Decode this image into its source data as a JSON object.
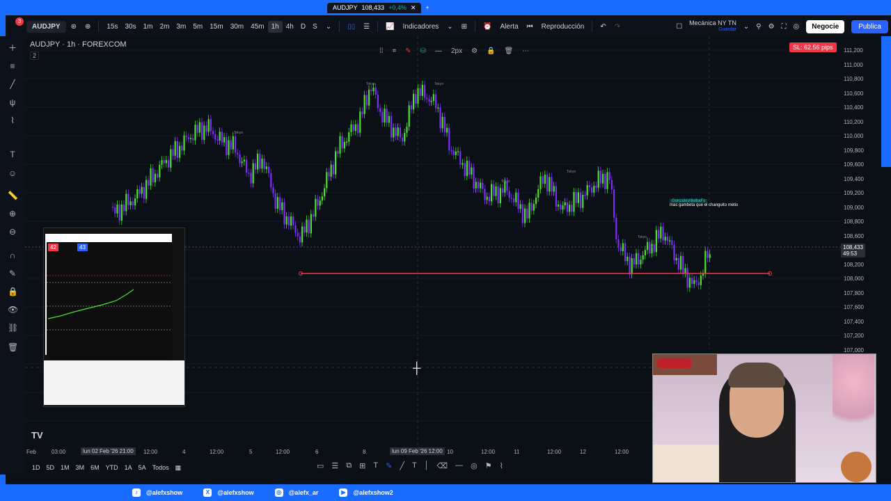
{
  "browser_tab": {
    "symbol": "AUDJPY",
    "price": "108,433",
    "change": "+0,4%"
  },
  "toolbar": {
    "symbol": "AUDJPY",
    "notif_count": "3",
    "timeframes": [
      "15s",
      "30s",
      "1m",
      "2m",
      "3m",
      "5m",
      "15m",
      "30m",
      "45m",
      "1h",
      "4h",
      "D",
      "S"
    ],
    "active_timeframe": "1h",
    "indicators_label": "Indicadores",
    "alert_label": "Alerta",
    "replay_label": "Reproducción",
    "template_name": "Mecánica NY TN",
    "template_save": "Guardar",
    "trade_label": "Negocie",
    "publish_label": "Publica"
  },
  "chart": {
    "title": "AUDJPY · 1h · FOREXCOM",
    "indicator_count": "2",
    "stroke_label": "2px",
    "sl_label": "SL: 62.56 pips",
    "current_price": "108,433",
    "countdown": "49:53",
    "price_ticks": [
      "111,200",
      "111,000",
      "110,800",
      "110,600",
      "110,400",
      "110,200",
      "110,000",
      "109,800",
      "109,600",
      "109,400",
      "109,200",
      "109,000",
      "108,800",
      "108,600",
      "108,400",
      "108,200",
      "108,000",
      "107,800",
      "107,600",
      "107,400",
      "107,200",
      "107,000"
    ],
    "time_ticks": [
      {
        "label": "Feb"
      },
      {
        "label": "03:00"
      },
      {
        "label": "lun 02 Feb '26  21:00",
        "hl": true
      },
      {
        "label": "12:00"
      },
      {
        "label": "4"
      },
      {
        "label": "12:00"
      },
      {
        "label": "5"
      },
      {
        "label": "12:00"
      },
      {
        "label": "6"
      },
      {
        "label": "8"
      },
      {
        "label": "lun 09 Feb '26  12:00",
        "hl": true
      },
      {
        "label": "10"
      },
      {
        "label": "12:00"
      },
      {
        "label": "11"
      },
      {
        "label": "12:00"
      },
      {
        "label": "12"
      },
      {
        "label": "12:00"
      }
    ],
    "session_labels": [
      "Tokyo",
      "Tokyo",
      "Tokyo",
      "Tokyo",
      "Tokyo",
      "Tokyo"
    ],
    "comment_user": "GonzaloVillalbaFx",
    "comment_text": "mas gambeta que el changuito metio",
    "colors": {
      "up": "#4be32b",
      "down": "#7b2ff7",
      "sl_line": "#f23645",
      "accent": "#2962ff"
    }
  },
  "bottom": {
    "ranges": [
      "1D",
      "5D",
      "1M",
      "3M",
      "6M",
      "YTD",
      "1A",
      "5A",
      "Todos"
    ]
  },
  "social": [
    {
      "icon": "tiktok-icon",
      "handle": "@alefxshow"
    },
    {
      "icon": "x-icon",
      "handle": "@alefxshow"
    },
    {
      "icon": "instagram-icon",
      "handle": "@alefx_ar"
    },
    {
      "icon": "youtube-icon",
      "handle": "@alefxshow2"
    }
  ],
  "pip": {
    "left_price": "42",
    "right_price": "43"
  }
}
